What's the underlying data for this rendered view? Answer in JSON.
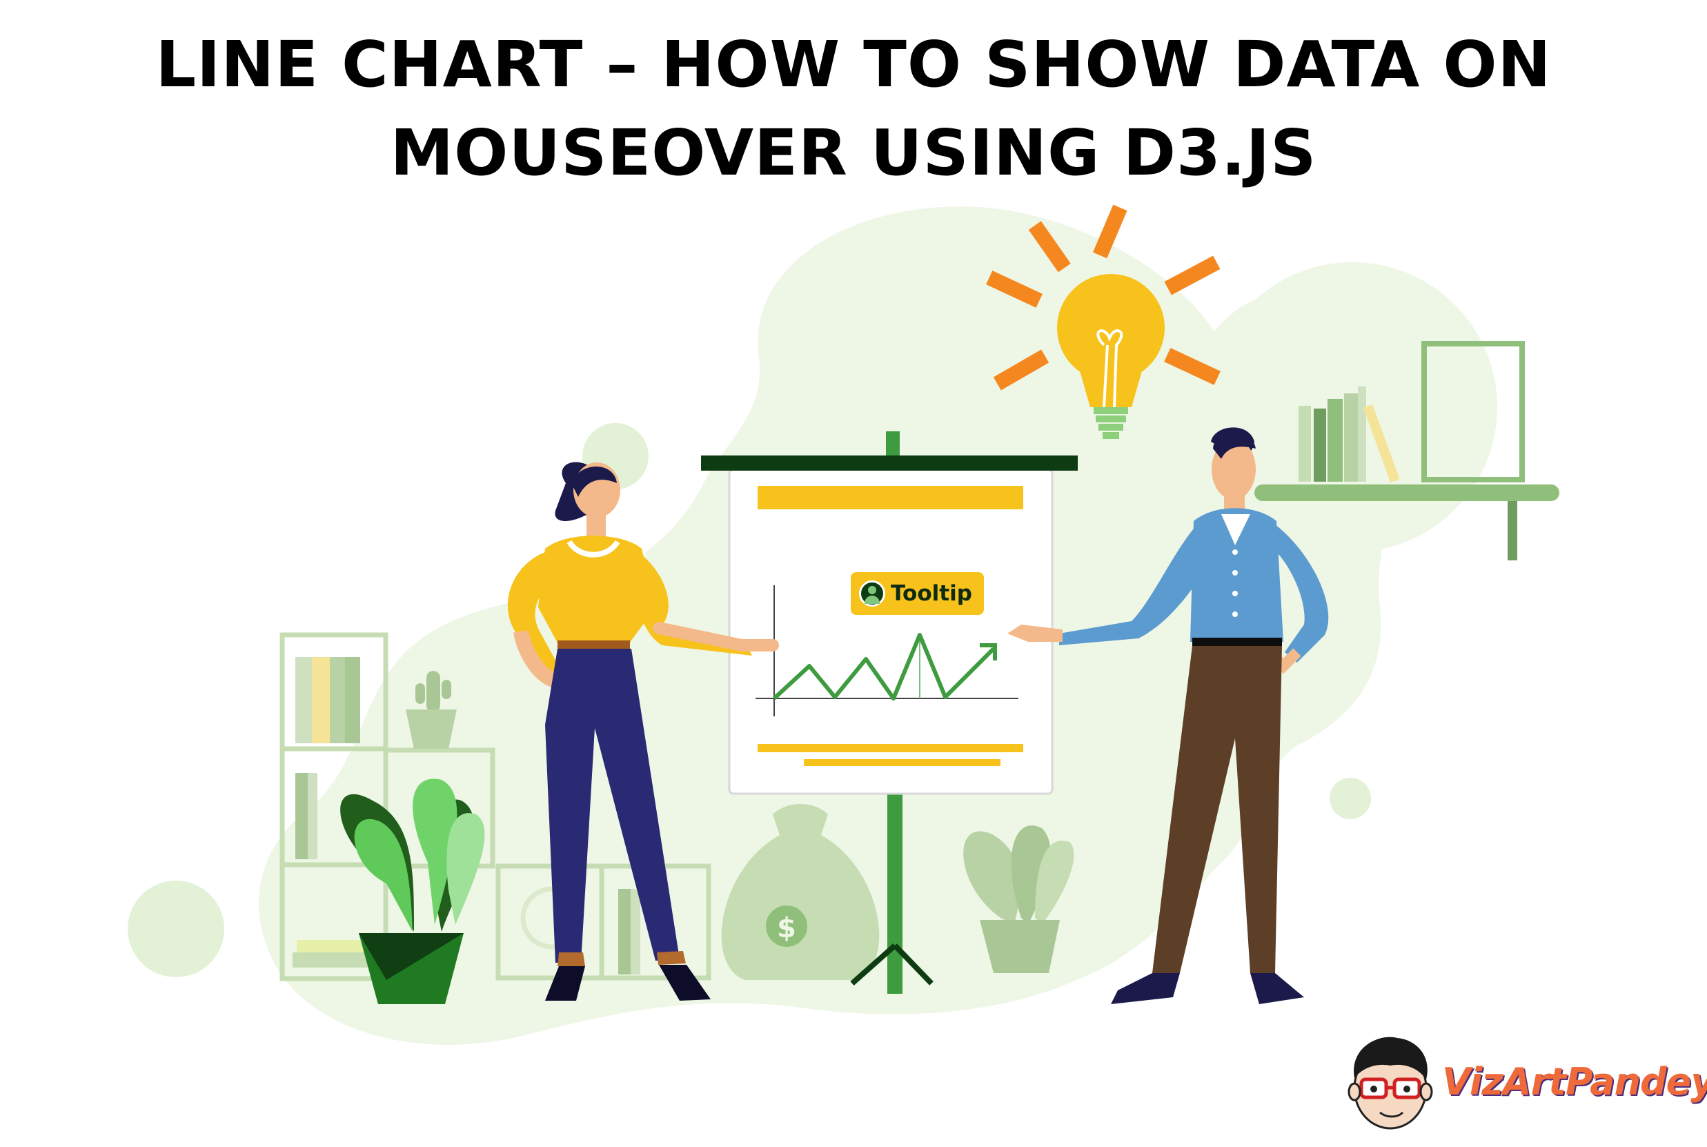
{
  "title": {
    "line1": "LINE CHART – HOW TO SHOW DATA ON",
    "line2": "MOUSEOVER USING D3.JS"
  },
  "board": {
    "tooltip_label": "Tooltip"
  },
  "money_bag": {
    "symbol": "$"
  },
  "brand": {
    "name": "VizArtPandey"
  },
  "colors": {
    "blob": "#eef6e5",
    "accent_yellow": "#f7c21b",
    "accent_orange": "#f5871f",
    "chart_line": "#3f9b3f",
    "board_frame": "#0d3b12"
  }
}
